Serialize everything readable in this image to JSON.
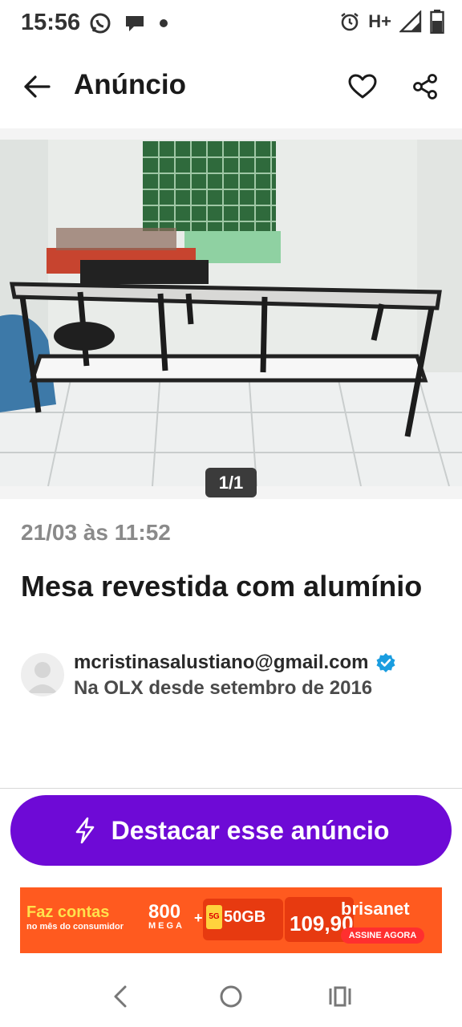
{
  "status_bar": {
    "time": "15:56",
    "network": "H+",
    "icons": [
      "whatsapp-icon",
      "chat-icon",
      "dot-icon",
      "alarm-icon",
      "signal-icon",
      "battery-icon"
    ]
  },
  "appbar": {
    "title": "Anúncio",
    "icons": [
      "arrow-back-icon",
      "heart-icon",
      "share-icon"
    ]
  },
  "gallery": {
    "counter": "1/1"
  },
  "listing": {
    "date": "21/03 às 11:52",
    "title": "Mesa revestida com alumínio"
  },
  "seller": {
    "email": "mcristinasalustiano@gmail.com",
    "since": "Na OLX desde setembro de 2016",
    "verified_icon": "verified-badge-icon"
  },
  "cta": {
    "label": "Destacar esse anúncio",
    "icon": "lightning-icon",
    "color": "#6e0ad6"
  },
  "ad": {
    "faz_contas": "Faz contas",
    "subtitle": "no mês do consumidor",
    "mega_number": "800",
    "mega_unit": "MEGA",
    "gb": "50GB",
    "chip": "5G",
    "price": "109,90",
    "brand": "brisanet",
    "cta": "ASSINE AGORA"
  },
  "navbar": {
    "icons": [
      "nav-back-icon",
      "nav-home-icon",
      "nav-recents-icon"
    ]
  }
}
